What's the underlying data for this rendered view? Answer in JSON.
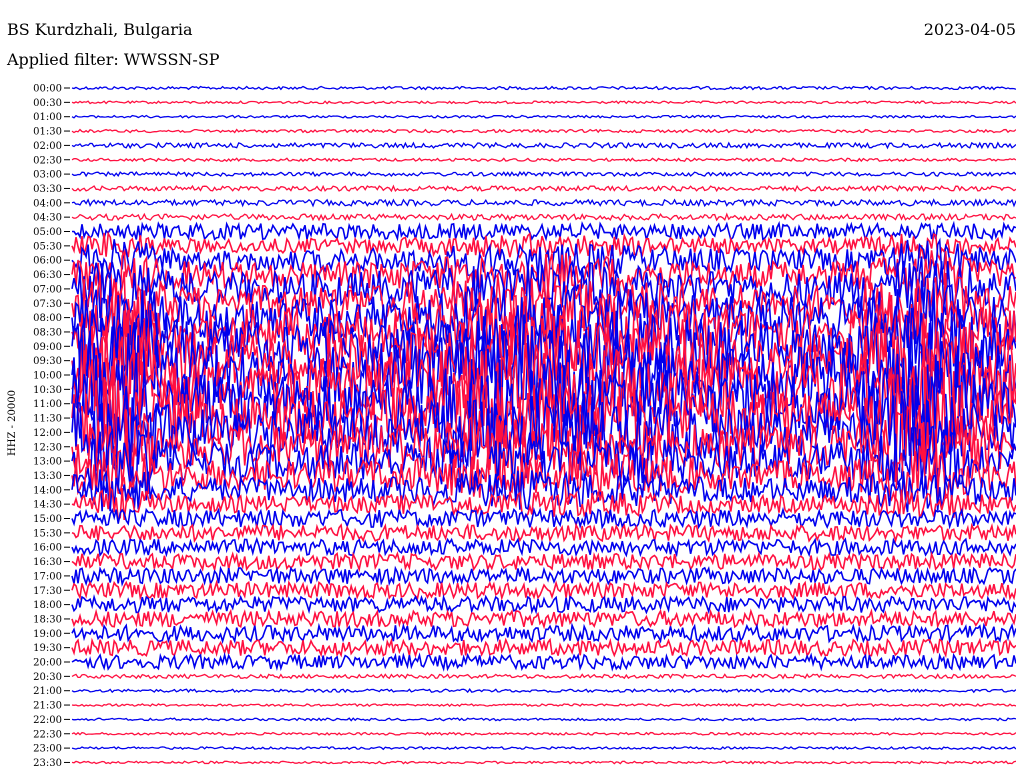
{
  "header": {
    "station": "BS Kurdzhali, Bulgaria",
    "date": "2023-04-05",
    "filter": "Applied filter: WWSSN-SP"
  },
  "chart_data": {
    "type": "line",
    "title": "BS Kurdzhali, Bulgaria",
    "ylabel": "HHZ - 20000",
    "colors": {
      "even_rows": "#0000ee",
      "odd_rows": "#ff1040"
    },
    "rows": [
      {
        "label": "00:00",
        "amp": 1.5
      },
      {
        "label": "00:30",
        "amp": 1.2
      },
      {
        "label": "01:00",
        "amp": 1.2
      },
      {
        "label": "01:30",
        "amp": 1.5
      },
      {
        "label": "02:00",
        "amp": 2.5
      },
      {
        "label": "02:30",
        "amp": 1.5
      },
      {
        "label": "03:00",
        "amp": 2
      },
      {
        "label": "03:30",
        "amp": 2.5
      },
      {
        "label": "04:00",
        "amp": 3
      },
      {
        "label": "04:30",
        "amp": 3
      },
      {
        "label": "05:00",
        "amp": 8
      },
      {
        "label": "05:30",
        "amp": 12
      },
      {
        "label": "06:00",
        "amp": 18
      },
      {
        "label": "06:30",
        "amp": 22
      },
      {
        "label": "07:00",
        "amp": 28
      },
      {
        "label": "07:30",
        "amp": 30
      },
      {
        "label": "08:00",
        "amp": 34
      },
      {
        "label": "08:30",
        "amp": 38
      },
      {
        "label": "09:00",
        "amp": 42
      },
      {
        "label": "09:30",
        "amp": 46
      },
      {
        "label": "10:00",
        "amp": 50
      },
      {
        "label": "10:30",
        "amp": 50
      },
      {
        "label": "11:00",
        "amp": 48
      },
      {
        "label": "11:30",
        "amp": 45
      },
      {
        "label": "12:00",
        "amp": 40
      },
      {
        "label": "12:30",
        "amp": 35
      },
      {
        "label": "13:00",
        "amp": 30
      },
      {
        "label": "13:30",
        "amp": 25
      },
      {
        "label": "14:00",
        "amp": 20
      },
      {
        "label": "14:30",
        "amp": 14
      },
      {
        "label": "15:00",
        "amp": 9
      },
      {
        "label": "15:30",
        "amp": 8
      },
      {
        "label": "16:00",
        "amp": 8
      },
      {
        "label": "16:30",
        "amp": 8
      },
      {
        "label": "17:00",
        "amp": 8
      },
      {
        "label": "17:30",
        "amp": 8
      },
      {
        "label": "18:00",
        "amp": 8
      },
      {
        "label": "18:30",
        "amp": 8
      },
      {
        "label": "19:00",
        "amp": 8
      },
      {
        "label": "19:30",
        "amp": 8
      },
      {
        "label": "20:00",
        "amp": 7
      },
      {
        "label": "20:30",
        "amp": 2
      },
      {
        "label": "21:00",
        "amp": 1.5
      },
      {
        "label": "21:30",
        "amp": 1.2
      },
      {
        "label": "22:00",
        "amp": 1.2
      },
      {
        "label": "22:30",
        "amp": 1.2
      },
      {
        "label": "23:00",
        "amp": 1.2
      },
      {
        "label": "23:30",
        "amp": 1.2
      }
    ]
  }
}
